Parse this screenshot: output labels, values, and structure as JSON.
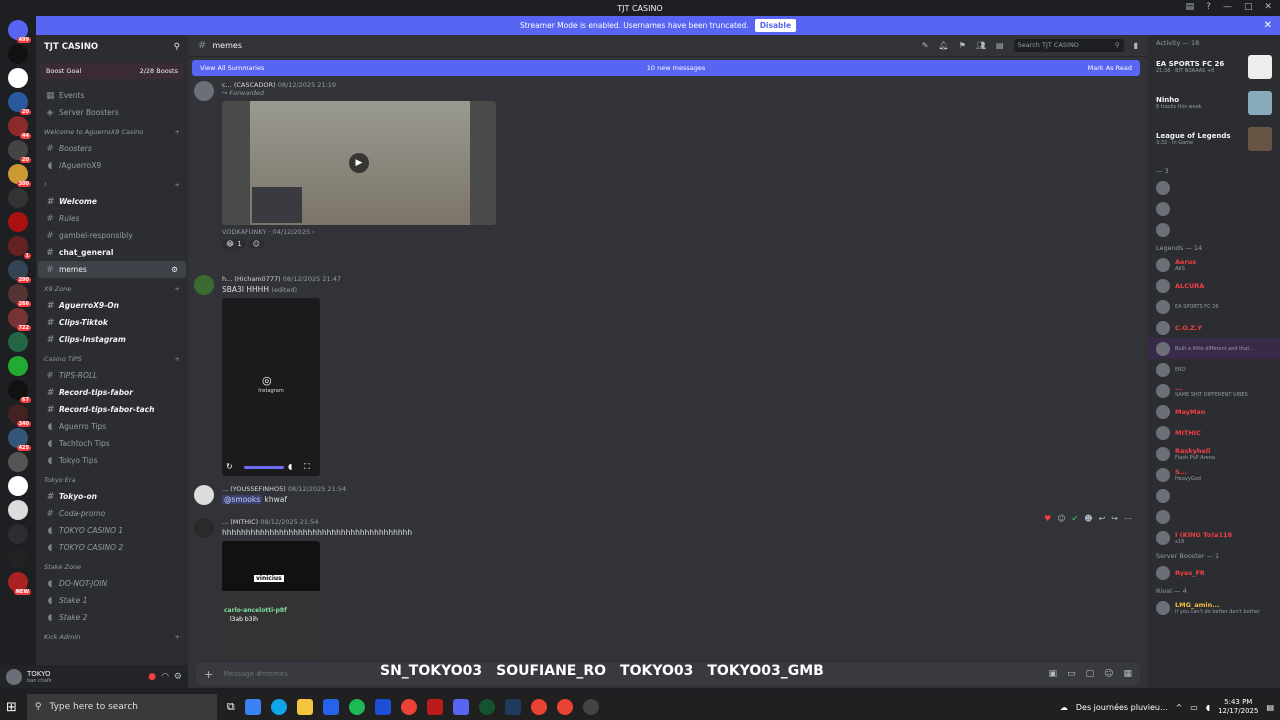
{
  "window": {
    "title": "TJT CASINO"
  },
  "banner": {
    "text": "Streamer Mode is enabled. Usernames have been truncated.",
    "disable": "Disable"
  },
  "server": {
    "name": "TJT CASINO",
    "boost_goal": "Boost Goal",
    "boosts": "2/28 Boosts"
  },
  "sidebar": {
    "top": [
      {
        "label": "Events"
      },
      {
        "label": "Server Boosters"
      }
    ],
    "categories": [
      {
        "label": "Welcome to AguerroX9 Casino",
        "channels": [
          "Boosters",
          "/AguerroX9"
        ]
      },
      {
        "label": "!",
        "channels": [
          "Welcome",
          "Rules",
          "gambel-responsibly"
        ]
      },
      {
        "label": "X9 Zone",
        "channels": [
          "AguerroX9-On",
          "Clips-Tiktok",
          "Clips-Instagram"
        ]
      },
      {
        "label": "Casino TIPS",
        "channels": [
          "TIPS-ROLL",
          "Record-tips-fabor",
          "Record-tips-fabor-tach",
          "Aguerro Tips",
          "Tachtoch Tips",
          "Tokyo Tips"
        ]
      },
      {
        "label": "Tokyo Era",
        "channels": [
          "Tokyo-on",
          "Coda-promo",
          "TOKYO CASINO 1",
          "TOKYO CASINO 2"
        ]
      },
      {
        "label": "Stake Zone",
        "channels": [
          "DO-NOT-JOIN",
          "Stake 1",
          "Stake 2"
        ]
      },
      {
        "label": "Kick Admin",
        "channels": []
      }
    ],
    "chat_general": "chat_general",
    "memes": "memes"
  },
  "user": {
    "name": "TOKYO",
    "status": "ban chafk"
  },
  "channel": {
    "name": "memes",
    "search_placeholder": "Search TJT CASINO"
  },
  "summary": {
    "left": "View All Summaries",
    "center": "10 new messages",
    "right": "Mark As Read"
  },
  "messages": [
    {
      "author": "c... (CASCADOR)",
      "time": "08/12/2025 21:19",
      "forwarded": "Forwarded",
      "footer": "VODKAFUNKY",
      "footer_date": "04/12/2025",
      "reaction_count": "1"
    },
    {
      "author": "h... (Hicham0777)",
      "time": "08/12/2025 21:47",
      "text": "SBA3I HHHH",
      "edited": "(edited)",
      "media_label": "Instagram"
    },
    {
      "author": "... (YOUSSEFINHO5)",
      "time": "08/12/2025 21:54",
      "mention": "@smooks",
      "text": "khwaf"
    },
    {
      "author": "... (MITHIC)",
      "time": "08/12/2025 21:54",
      "text": "hhhhhhhhhhhhhhhhhhhhhhhhhhhhhhhhhhhhhhhh",
      "media_caption1": "vinicius",
      "media_caption2": "carlo-ancelotti-p8f",
      "media_caption3": "l3ab b3ih"
    }
  ],
  "composer": {
    "placeholder": "Message #memes"
  },
  "overlay": [
    "SN_TOKYO03",
    "SOUFIANE_RO",
    "TOKYO03",
    "TOKYO03_GMB"
  ],
  "members": {
    "activity_header": "Activity — 18",
    "activities": [
      {
        "title": "EA SPORTS FC 26",
        "sub": "21:38 · BIT N3AAAS +8"
      },
      {
        "title": "Ninho",
        "sub": "6 tracks this week"
      },
      {
        "title": "League of Legends",
        "sub": "3:32 · In Game"
      }
    ],
    "section3": "— 3",
    "legends": "Legends — 14",
    "legend_names": [
      "Aerus",
      "ALCURA",
      "",
      "C.O.Z.Y",
      "",
      "",
      "...",
      "MayMan",
      "MITHIC",
      "Raskyhell",
      "S...",
      "",
      "",
      "I (KING To)a118"
    ],
    "legend_subs": [
      "AKS",
      "",
      "EA SPORTS FC 26",
      "",
      "Built a little different and that...",
      "ERO",
      "SAME SHIT DIFFERENT VIBES",
      "",
      "",
      "Flash PvP Arena",
      "HeavyGod",
      "",
      "",
      "x18"
    ],
    "server_booster": "Server Booster — 1",
    "booster_name": "Ryes_FR",
    "rival": "Rival — 4",
    "rival_name": "LMG_amin...",
    "rival_sub": "If you can't do better don't bother"
  },
  "taskbar": {
    "search": "Type here to search",
    "weather": "Des journées pluvieu...",
    "time": "5:43 PM",
    "date": "12/17/2025"
  }
}
